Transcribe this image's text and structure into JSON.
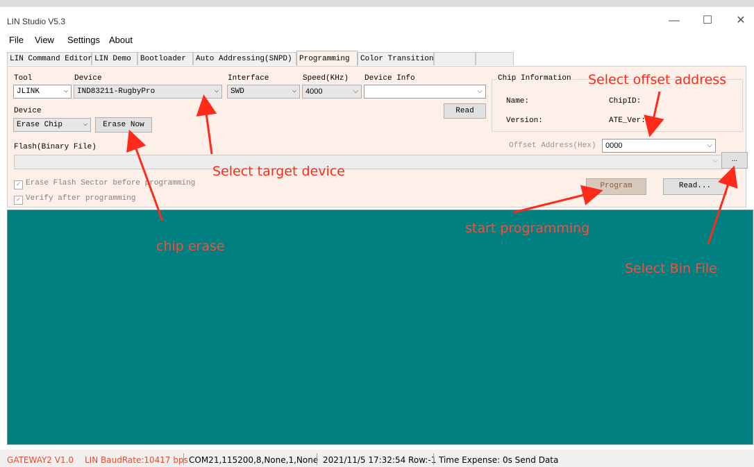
{
  "window": {
    "title": "LIN Studio V5.3",
    "controls": {
      "minimize": "—",
      "maximize": "☐",
      "close": "✕"
    }
  },
  "menu": [
    "File",
    "View",
    "Settings",
    "About"
  ],
  "tabs": [
    "LIN Command Editor",
    "LIN Demo",
    "Bootloader",
    "Auto Addressing(SNPD)",
    "Programming",
    "Color Transition"
  ],
  "active_tab": "Programming",
  "panel": {
    "tool": {
      "label": "Tool",
      "value": "JLINK"
    },
    "device": {
      "label": "Device",
      "value": "IND83211-RugbyPro"
    },
    "interface": {
      "label": "Interface",
      "value": "SWD"
    },
    "speed": {
      "label": "Speed(KHz)",
      "value": "4000"
    },
    "device_info": {
      "label": "Device Info",
      "value": ""
    },
    "read_button": "Read",
    "erase": {
      "label": "Device",
      "value": "Erase Chip",
      "button": "Erase Now"
    },
    "chip_info": {
      "title": "Chip Information",
      "name_label": "Name:",
      "chipid_label": "ChipID:",
      "version_label": "Version:",
      "ate_label": "ATE_Ver:"
    },
    "flash_label": "Flash(Binary File)",
    "offset": {
      "label": "Offset Address(Hex)",
      "value": "0000"
    },
    "browse_button": "...",
    "erase_sector_check": "Erase Flash Sector before programming",
    "verify_check": "Verify after programming",
    "program_button": "Program",
    "read_dots_button": "Read..."
  },
  "status": {
    "gateway": "GATEWAY2  V1.0",
    "baud": "LIN BaudRate:10417 bps",
    "port": "COM21,115200,8,None,1,None",
    "time_row": "2021/11/5 17:32:54  Row:-1",
    "expense": "Time Expense: 0s  Send Data"
  },
  "annotations": {
    "offset": "Select offset address",
    "device": "Select target device",
    "chip_erase": "chip erase",
    "start": "start programming",
    "bin": "Select Bin File"
  },
  "colors": {
    "log_bg": "#008080",
    "panel_bg": "#fdf0e8",
    "annotation": "#ff2a1a",
    "status_red": "#e84a2a"
  }
}
